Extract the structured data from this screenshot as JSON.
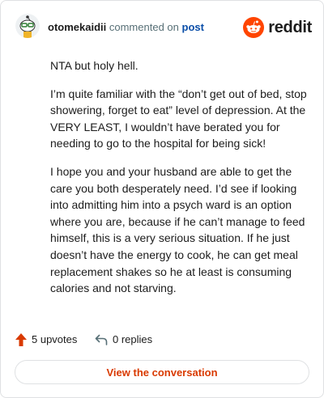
{
  "comment": {
    "username": "otomekaidii",
    "action_text": "commented on",
    "target_link": "post",
    "paragraphs": [
      "NTA but holy hell.",
      "I’m quite familiar with the “don’t get out of bed, stop showering, forget to eat” level of depression. At the VERY LEAST, I wouldn’t have berated you for needing to go to the hospital for being sick!",
      "I hope you and your husband are able to get the care you both desperately need. I’d see if looking into admitting him into a psych ward is an option where you are, because if he can’t manage to feed himself, this is a very serious situation. If he just doesn’t have the energy to cook, he can get meal replacement shakes so he at least is consuming calories and not starving."
    ]
  },
  "brand": {
    "name": "reddit",
    "icon": "reddit-logo-icon",
    "color": "#ff4500"
  },
  "stats": {
    "upvotes_label": "5 upvotes",
    "upvote_icon": "upvote-arrow-icon",
    "upvote_color": "#d93a00",
    "replies_label": "0 replies",
    "reply_icon": "reply-arrow-icon"
  },
  "cta": {
    "label": "View the conversation",
    "color": "#d93a00"
  }
}
